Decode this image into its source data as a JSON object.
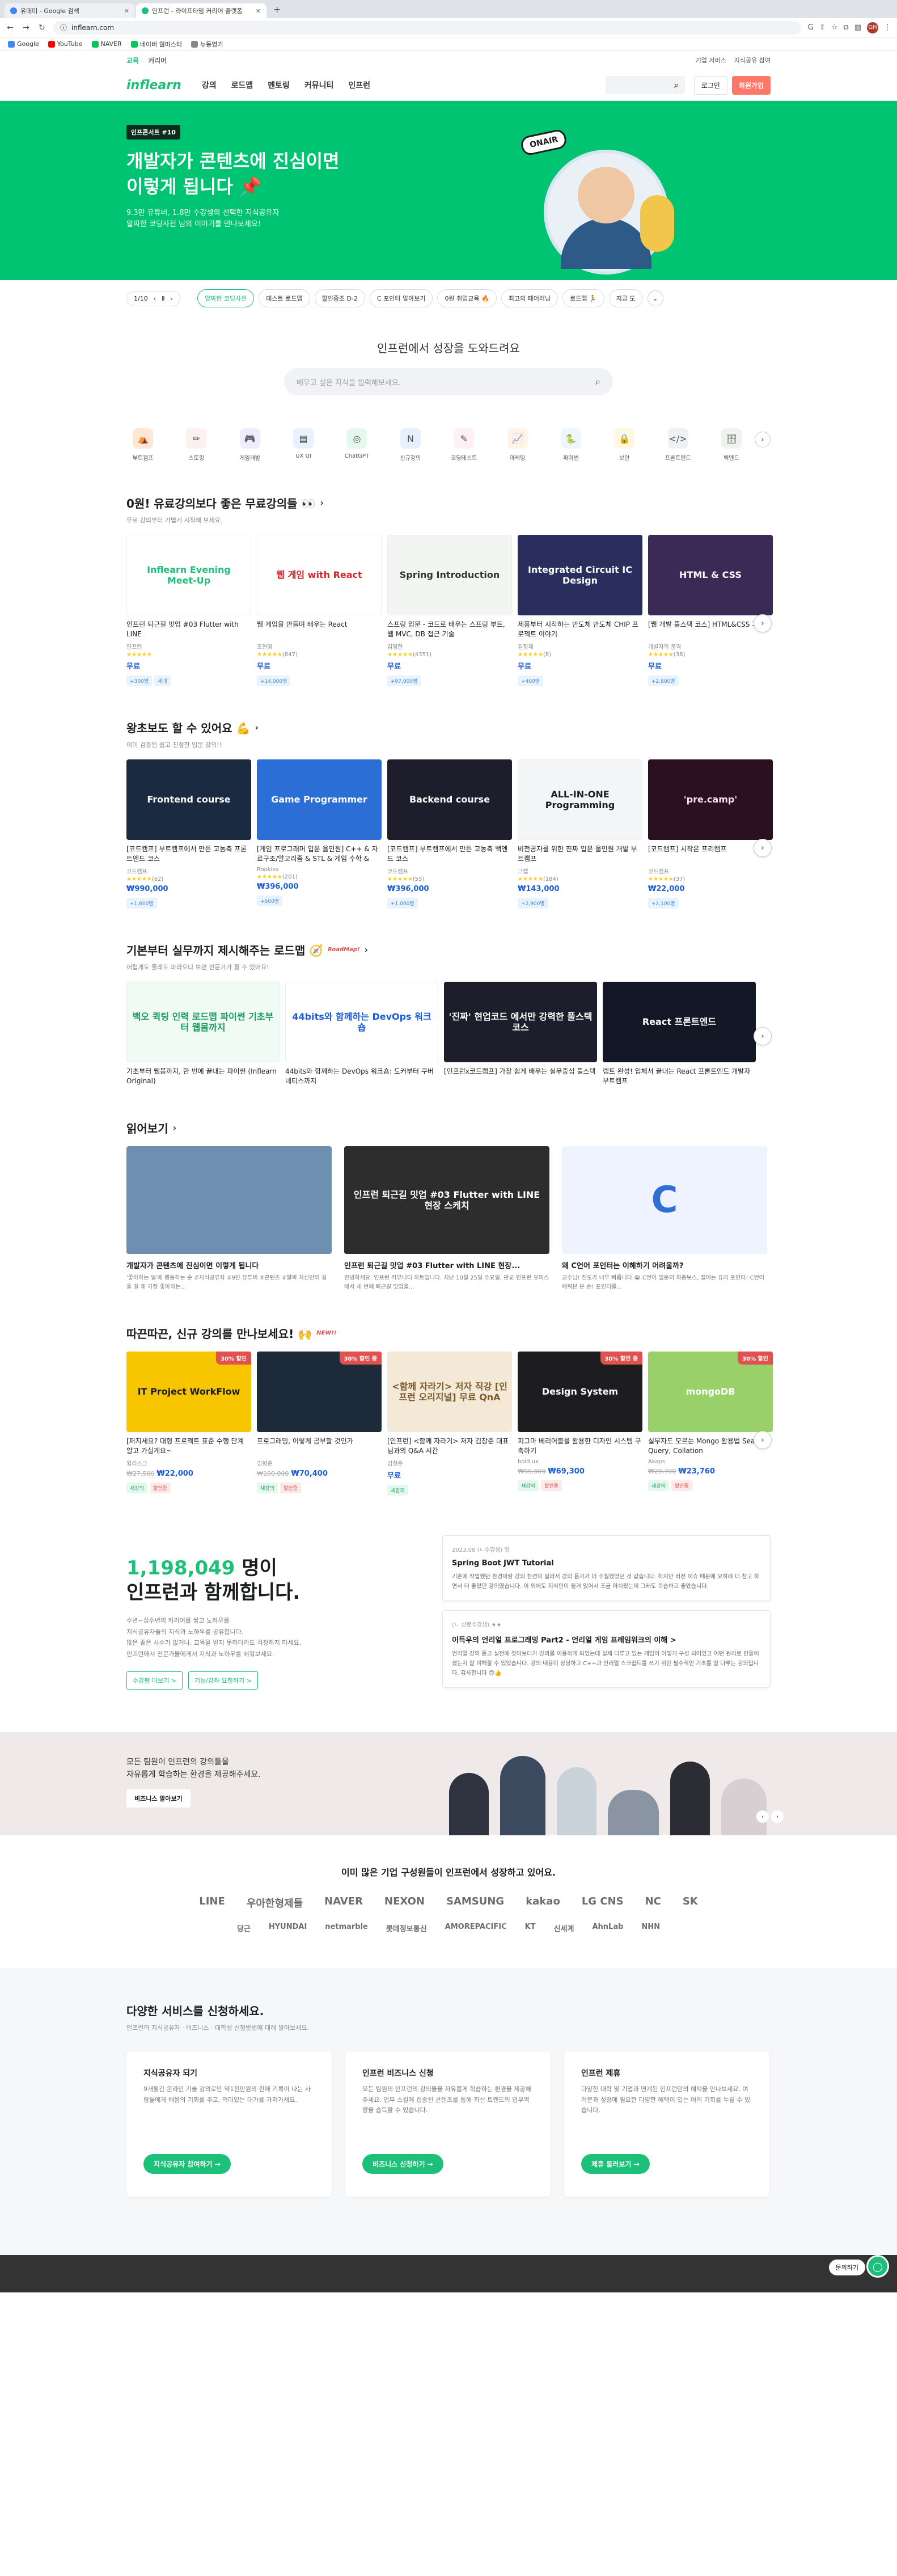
{
  "browser": {
    "tabs": [
      {
        "title": "유데미 - Google 검색"
      },
      {
        "title": "인프런 - 라이프타임 커리어 플랫폼"
      }
    ],
    "url": "inflearn.com",
    "profile": "GH",
    "bookmarks": [
      "Google",
      "YouTube",
      "NAVER",
      "네이버 웹마스터",
      "뉴동영기"
    ]
  },
  "topbar": {
    "left": [
      "교육",
      "커리어"
    ],
    "right": [
      "기업 서비스",
      "지식공유 참여"
    ]
  },
  "gnb": {
    "logo": "inflearn",
    "menu": [
      "강의",
      "로드맵",
      "멘토링",
      "커뮤니티",
      "인프런"
    ],
    "login": "로그인",
    "join": "회원가입"
  },
  "hero": {
    "badge": "인프콘서트 #10",
    "title_line1": "개발자가 콘텐츠에 진심이면",
    "title_line2": "이렇게 됩니다 📌",
    "sub_line1": "9.3만 유튜버, 1.8만 수강생의 선택한 지식공유자",
    "sub_line2": "알짜한 코딩사전 님의 이야기를 만나보세요!",
    "onair": "ONAIR"
  },
  "chips": {
    "pager": "1/10",
    "items": [
      "얄짜한 코딩사전",
      "테스트 로드맵",
      "할인중조 D-2",
      "C 포인터 알아보기",
      "0원 취업교육 🔥",
      "최고의 페어러님",
      "로드맵 🏃",
      "지금 도"
    ]
  },
  "search": {
    "title": "인프런에서 성장을 도와드려요",
    "placeholder": "배우고 싶은 지식을 입력해보세요."
  },
  "categories": [
    {
      "label": "부트캠프",
      "icon": "⛺",
      "color": "#fde8d8"
    },
    {
      "label": "스토링",
      "icon": "✏",
      "color": "#fff0f0"
    },
    {
      "label": "게임개발",
      "icon": "🎮",
      "color": "#f0ecff"
    },
    {
      "label": "UX UI",
      "icon": "▤",
      "color": "#e8f2ff"
    },
    {
      "label": "ChatGPT",
      "icon": "◎",
      "color": "#e5f8ef"
    },
    {
      "label": "신규강의",
      "icon": "N",
      "color": "#e6f0ff"
    },
    {
      "label": "코딩테스트",
      "icon": "✎",
      "color": "#fff0f6"
    },
    {
      "label": "마케팅",
      "icon": "📈",
      "color": "#fff4e5"
    },
    {
      "label": "파이썬",
      "icon": "🐍",
      "color": "#eef6ff"
    },
    {
      "label": "보안",
      "icon": "🔒",
      "color": "#fff7e0"
    },
    {
      "label": "프론트엔드",
      "icon": "</>",
      "color": "#eef0f3"
    },
    {
      "label": "백엔드",
      "icon": "🗄",
      "color": "#eef3f0"
    }
  ],
  "free_section": {
    "title": "0원! 유료강의보다 좋은 무료강의들 👀",
    "sub": "무료 강의부터 가볍게 시작해 보세요.",
    "cards": [
      {
        "thumb": "Inflearn Evening Meet-Up",
        "bg": "#ffffff",
        "fg": "#1dc078",
        "title": "인프런 퇴근길 밋업 #03 Flutter with LINE",
        "author": "인프런",
        "stars": "★★★★★",
        "count": "",
        "price": "무료",
        "tags": [
          "+300명",
          "세대"
        ]
      },
      {
        "thumb": "웹 게임 with React",
        "bg": "#ffffff",
        "fg": "#d8232a",
        "title": "웹 게임을 만들며 배우는 React",
        "author": "조현영",
        "stars": "★★★★★",
        "count": "(847)",
        "price": "무료",
        "tags": [
          "+14,000명"
        ]
      },
      {
        "thumb": "Spring Introduction",
        "bg": "#f3f5f2",
        "fg": "#333333",
        "title": "스프링 입문 - 코드로 배우는 스프링 부트, 웹 MVC, DB 접근 기술",
        "author": "김영한",
        "stars": "★★★★★",
        "count": "(4351)",
        "price": "무료",
        "tags": [
          "+97,000명"
        ]
      },
      {
        "thumb": "Integrated Circuit IC Design",
        "bg": "#2a2e5c",
        "fg": "#ffffff",
        "title": "제품부터 시작하는 반도체 반도체 CHIP 프로젝트 이야기",
        "author": "김정재",
        "stars": "★★★★★",
        "count": "(8)",
        "price": "무료",
        "tags": [
          "+400명"
        ]
      },
      {
        "thumb": "HTML & CSS",
        "bg": "#3a2a55",
        "fg": "#ffffff",
        "title": "[웹 개발 풀스택 코스] HTML&CSS 기초",
        "author": "개발자의 품격",
        "stars": "★★★★★",
        "count": "(38)",
        "price": "무료",
        "tags": [
          "+2,800명"
        ]
      }
    ]
  },
  "beginner_section": {
    "title": "왕초보도 할 수 있어요 💪",
    "sub": "이미 검증된 쉽고 친절한 입문 강의!!",
    "cards": [
      {
        "thumb": "Frontend course",
        "bg": "#1a2a40",
        "fg": "#ffffff",
        "title": "[코드캠프] 부트캠프에서 만든 고농축 프론트엔드 코스",
        "author": "코드캠프",
        "stars": "★★★★★",
        "count": "(62)",
        "price": "₩990,000",
        "tags": [
          "+1,600명"
        ]
      },
      {
        "thumb": "Game Programmer",
        "bg": "#2b6fd6",
        "fg": "#ffffff",
        "title": "[게임 프로그래머 입문 올인원] C++ & 자료구조/알고리즘 & STL & 게임 수학 & Windows API",
        "author": "Rookiss",
        "stars": "★★★★★",
        "count": "(201)",
        "price": "₩396,000",
        "tags": [
          "+600명"
        ]
      },
      {
        "thumb": "Backend course",
        "bg": "#1d1d2c",
        "fg": "#ffffff",
        "title": "[코드캠프] 부트캠프에서 만든 고농축 백엔드 코스",
        "author": "코드캠프",
        "stars": "★★★★★",
        "count": "(55)",
        "price": "₩396,000",
        "tags": [
          "+1,000명"
        ]
      },
      {
        "thumb": "ALL-IN-ONE Programming",
        "bg": "#f4f5f6",
        "fg": "#1b1c1d",
        "title": "비전공자를 위한 진짜 입문 올인원 개발 부트캠프",
        "author": "그랩",
        "stars": "★★★★★",
        "count": "(184)",
        "price": "₩143,000",
        "tags": [
          "+2,900명"
        ]
      },
      {
        "thumb": "'pre.camp'",
        "bg": "#2a1020",
        "fg": "#ffe0ee",
        "title": "[코드캠프] 시작은 프리캠프",
        "author": "코드캠프",
        "stars": "★★★★★",
        "count": "(37)",
        "price": "₩22,000",
        "tags": [
          "+2,100명"
        ]
      }
    ]
  },
  "roadmap_section": {
    "title": "기본부터 실무까지 제시해주는 로드맵 🧭",
    "badge": "RoadMap!",
    "sub": "어렵게도 몰래도 파라오다 보면 전문가가 될 수 있어요!",
    "cards": [
      {
        "thumb": "백오 퀵팅 인력 로드맵 파이썬 기초부터 웹몸까지",
        "bg": "#f0fbf4",
        "fg": "#1a9a5f",
        "title": "기초부터 웹몸까지, 한 번에 끝내는 파이썬 (Inflearn Original)"
      },
      {
        "thumb": "44bits와 함께하는 DevOps 워크숍",
        "bg": "#ffffff",
        "fg": "#1b5dd6",
        "title": "44bits와 함께하는 DevOps 워크숍: 도커부터 쿠버네티스까지"
      },
      {
        "thumb": "'진짜' 현업코드 에서만 강력한 풀스택 코스",
        "bg": "#1d1d2c",
        "fg": "#ffffff",
        "title": "[인프런x코드캠프] 가장 쉽게 배우는 실무중심 풀스택"
      },
      {
        "thumb": "React 프론트엔드",
        "bg": "#141826",
        "fg": "#ffffff",
        "title": "렙트 완성! 입체서 끝내는 React 프론트엔드 개발자 부트캠프"
      }
    ]
  },
  "reading_section": {
    "title": "읽어보기",
    "items": [
      {
        "thumb": "",
        "bg": "#6d8fb0",
        "fg": "#ffffff",
        "title": "개발자가 콘텐츠에 진심이면 이렇게 됩니다",
        "desc": "'좋아하는 일'에 행동하는 순 #지식공유자 #9만 유튜버 #콘텐츠 #얄짜 자신만의 길을 걸 왜 가장 좋아하는..."
      },
      {
        "thumb": "인프런 퇴근길 밋업 #03 Flutter with LINE 현장 스케치",
        "bg": "#2d2d2d",
        "fg": "#ffffff",
        "title": "인프런 퇴근길 밋업 #03 Flutter with LINE 현장...",
        "desc": "안녕하세요. 인프런 커뮤니티 하트입니다. 지난 10월 25일 수요일, 판교 인프런 오피스에서 세 번째 퇴근길 밋업을..."
      },
      {
        "thumb": "C",
        "bg": "#eef3ff",
        "fg": "#2f6fd6",
        "title": "왜 C언어 포인터는 이해하기 어려울까?",
        "desc": "교수님! 진도가 너무 빠릅니다 😭 C언어 입문의 최종보스, 절어는 유리 포인터! C언어 배워본 분 손! 포인터를..."
      }
    ]
  },
  "new_section": {
    "title": "따끈따끈, 신규 강의를 만나보세요! 🙌",
    "badge": "NEW!!",
    "cards": [
      {
        "thumb": "IT Project WorkFlow",
        "bg": "#f7c600",
        "fg": "#1b1c1d",
        "discount": "30% 할인",
        "title": "[퍼지세요? 대형 프로젝트 표준 수행 단계 알고 가실게요~",
        "author": "윌리스그",
        "old": "₩27,500",
        "price": "₩22,000",
        "tags": [
          "새강의",
          "할인중"
        ]
      },
      {
        "thumb": "",
        "bg": "#1d2a3a",
        "fg": "#ffffff",
        "discount": "30% 할인 중",
        "title": "프로그래밍, 이렇게 공부할 것인가",
        "author": "김형준",
        "old": "₩100,000",
        "price": "₩70,400",
        "tags": [
          "새강의",
          "할인중"
        ]
      },
      {
        "thumb": "<함께 자라기> 저자 직강 [인프런 오리지널] 무료 QnA",
        "bg": "#f3e9d6",
        "fg": "#7a5a2a",
        "discount": "",
        "title": "[인프런] <함께 자라기> 저자 김창준 대표님과의 Q&A 시간",
        "author": "김창준",
        "old": "",
        "price": "무료",
        "tags": [
          "새강의"
        ]
      },
      {
        "thumb": "Design System",
        "bg": "#1d1d1f",
        "fg": "#ffffff",
        "discount": "30% 할인 중",
        "title": "피그마 베리어블을 활용한 디자인 시스템 구축하기",
        "author": "bold.ux",
        "old": "₩99,000",
        "price": "₩69,300",
        "tags": [
          "새강의",
          "할인중"
        ]
      },
      {
        "thumb": "mongoDB",
        "bg": "#9ad06a",
        "fg": "#ffffff",
        "discount": "30% 할인",
        "title": "실무자도 모르는 Mongo 활용법 Search, Query, Collation",
        "author": "Akaps",
        "old": "₩29,700",
        "price": "₩23,760",
        "tags": [
          "새강의",
          "할인중"
        ]
      }
    ]
  },
  "stats": {
    "number": "1,198,049",
    "number_suffix": " 명이",
    "title": "인프런과 함께합니다.",
    "desc1": "수년~십수년의 커리어를 쌓고 노하우를",
    "desc2": "지식공유자들의 지식과 노하우를 공유합니다.",
    "desc3": "많은 좋은 사수가 없거나, 교육을 받지 못하더라도 걱정하지 마세요.",
    "desc4": "인프런에서 전문가들에게서 지식과 노하우를 배워보세요.",
    "btn1": "수강평 더보기 >",
    "btn2": "기능/강좌 요청하기 >"
  },
  "reviews": [
    {
      "meta": "2023.08 (ㄴ수강생) 멍",
      "title": "Spring Boot JWT Tutorial",
      "body": "기존에 작업했던 환경이랑 강의 환경이 달라서 강의 듣기가 더 수월했었던 것 같습니다. 하지만 버전 이슈 때문에 오히려 더 참고 하면서 더 좋았던 강의였습니다. 이 외에도 지식인이 될거 있어서 조금 아쉬웠는데 그래도 복습하고 좋았습니다."
    },
    {
      "meta": "(ㄴ 상료수강생) ★★",
      "title": "이득우의 언리얼 프로그래밍 Part2 - 언리얼 게임 프레임워크의 이해 >",
      "body": "언리얼 강의 듣고 실전에 찾아보다가 강의를 이용하게 되었는데 실제 다루고 있는 게임이 어떻게 구성 되어있고 어떤 원리로 만들어졌는지 잘 이해할 수 있었습니다. 강의 내용이 상당하고 C++과 언리얼 스크립트를 쓰기 위한 필수적인 기초를 잘 다루는 강의입니다. 감사합니다 😊👍"
    }
  ],
  "biz": {
    "title1": "모든 팀원이 인프런의 강의들을",
    "title2": "자유롭게 학습하는 환경을 제공해주세요.",
    "btn": "비즈니스 알아보기"
  },
  "partners": {
    "title": "이미 많은 기업 구성원들이 인프런에서 성장하고 있어요.",
    "row1": [
      "LINE",
      "우아한형제들",
      "NAVER",
      "NEXON",
      "SAMSUNG",
      "kakao",
      "LG CNS",
      "NC",
      "SK"
    ],
    "row2": [
      "당근",
      "HYUNDAI",
      "netmarble",
      "롯데정보통신",
      "AMOREPACIFIC",
      "KT",
      "신세계",
      "AhnLab",
      "NHN"
    ]
  },
  "services": {
    "title": "다양한 서비스를 신청하세요.",
    "sub": "인프런의 지식공유자 · 비즈니스 · 대학생 신청방법에 대해 알아보세요.",
    "items": [
      {
        "title": "지식공유자 되기",
        "desc": "9개월간 온라인 기술 강의로만 약1천만원의 판매 기록이 나는 사람들에게 배움의 기회를 주고, 의미있는 대가를 가져가세요.",
        "btn": "지식공유자 참여하기 →"
      },
      {
        "title": "인프런 비즈니스 신청",
        "desc": "모든 팀원의 인프런의 강의들을 자유롭게 학습하는 환경을 제공해주세요. 업무 스킬에 집중된 콘텐츠를 통해 최신 트렌드의 업무역량을 습득할 수 있습니다.",
        "btn": "비즈니스 신청하기 →"
      },
      {
        "title": "인프런 제휴",
        "desc": "다양한 대학 및 기업과 연계된 인프런만의 혜택을 만나보세요. 여러분과 성장에 필요한 다양한 혜택이 있는 여러 기회를 누릴 수 있습니다.",
        "btn": "제휴 둘러보기 →"
      }
    ]
  },
  "fab": {
    "ask": "문의하기"
  }
}
